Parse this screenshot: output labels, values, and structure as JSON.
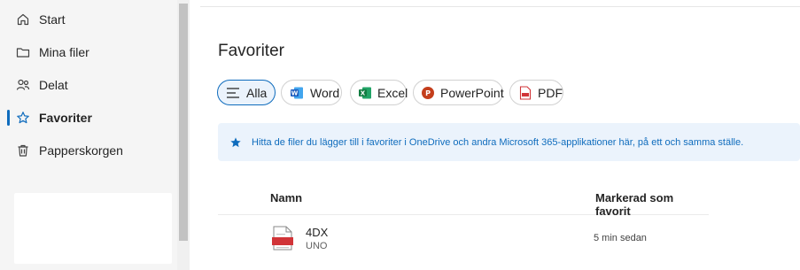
{
  "sidebar": {
    "items": [
      {
        "label": "Start",
        "icon": "home-icon"
      },
      {
        "label": "Mina filer",
        "icon": "folder-icon"
      },
      {
        "label": "Delat",
        "icon": "people-icon"
      },
      {
        "label": "Favoriter",
        "icon": "star-icon",
        "active": true
      },
      {
        "label": "Papperskorgen",
        "icon": "trash-icon"
      }
    ]
  },
  "main": {
    "title": "Favoriter",
    "filters": [
      {
        "label": "Alla",
        "icon": "lines-icon",
        "selected": true
      },
      {
        "label": "Word",
        "icon": "word-icon"
      },
      {
        "label": "Excel",
        "icon": "excel-icon"
      },
      {
        "label": "PowerPoint",
        "icon": "powerpoint-icon"
      },
      {
        "label": "PDF",
        "icon": "pdf-icon"
      }
    ],
    "banner": {
      "text": "Hitta de filer du lägger till i favoriter i OneDrive och andra Microsoft 365-applikationer här, på ett och samma ställe.",
      "icon": "star-filled-icon"
    },
    "table": {
      "columns": [
        "Namn",
        "Markerad som favorit"
      ],
      "rows": [
        {
          "name": "4DX",
          "location": "UNO",
          "favorited": "5 min sedan",
          "icon": "pdf-file-icon"
        }
      ]
    }
  },
  "colors": {
    "accent": "#0f6cbd",
    "banner_bg": "#ebf3fc",
    "sidebar_bg": "#f5f5f5",
    "word": "#185abd",
    "excel": "#107c41",
    "powerpoint": "#c43e1c",
    "pdf": "#d13438"
  }
}
